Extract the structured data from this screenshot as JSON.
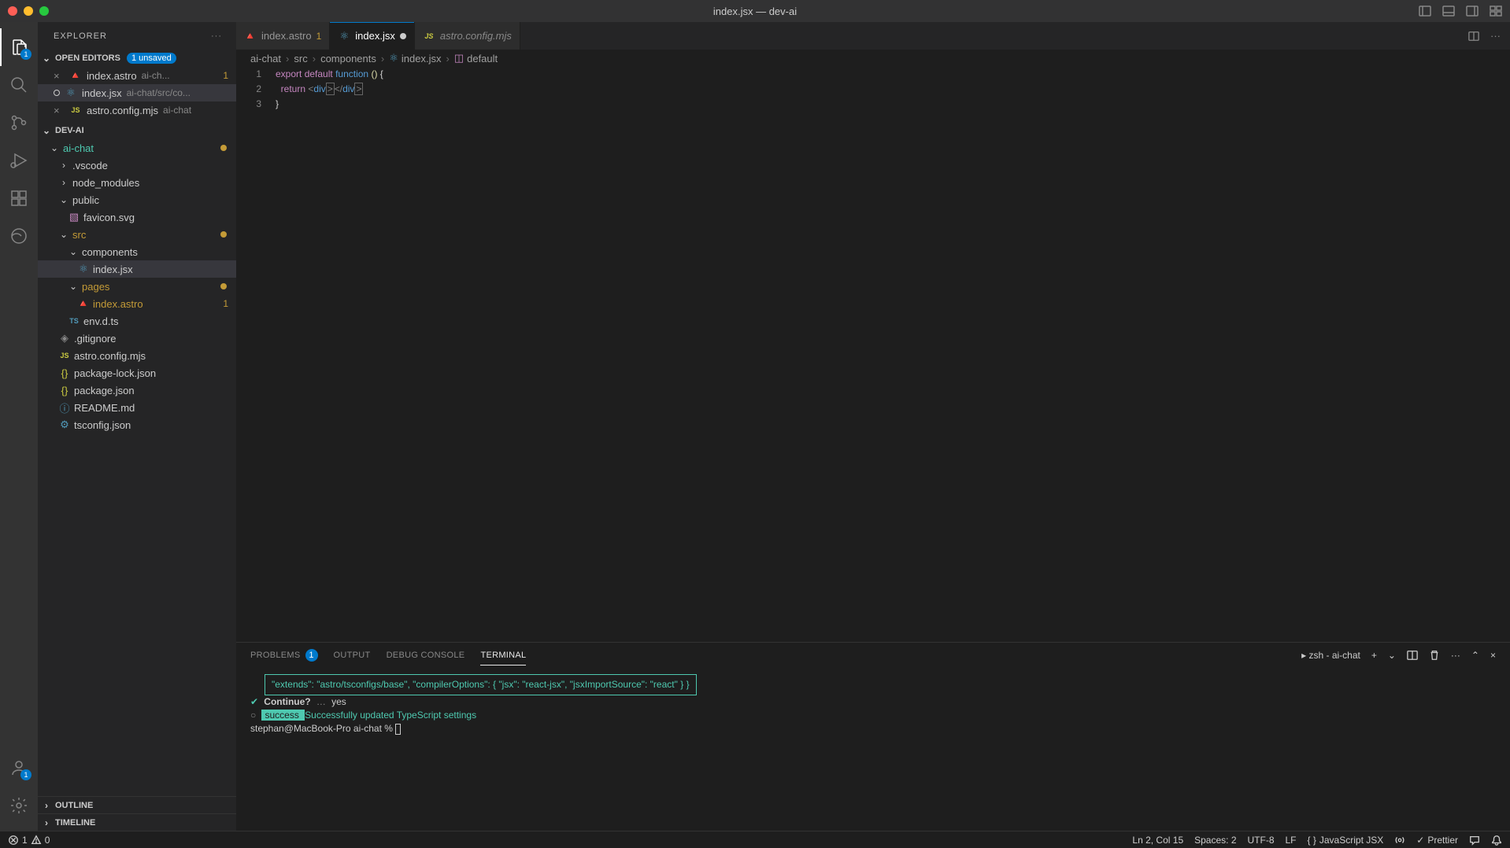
{
  "title_bar": {
    "title": "index.jsx — dev-ai"
  },
  "activity_bar": {
    "explorer_badge": "1",
    "accounts_badge": "1"
  },
  "sidebar": {
    "title": "EXPLORER",
    "open_editors": {
      "label": "OPEN EDITORS",
      "unsaved_badge": "1 unsaved",
      "items": [
        {
          "name": "index.astro",
          "desc": "ai-ch...",
          "warn": "1"
        },
        {
          "name": "index.jsx",
          "desc": "ai-chat/src/co..."
        },
        {
          "name": "astro.config.mjs",
          "desc": "ai-chat"
        }
      ]
    },
    "workspace_label": "DEV-AI",
    "tree": {
      "ai_chat": "ai-chat",
      "vscode": ".vscode",
      "node_modules": "node_modules",
      "public": "public",
      "favicon": "favicon.svg",
      "src": "src",
      "components": "components",
      "index_jsx": "index.jsx",
      "pages": "pages",
      "index_astro": "index.astro",
      "index_astro_warn": "1",
      "env": "env.d.ts",
      "gitignore": ".gitignore",
      "astro_config": "astro.config.mjs",
      "package_lock": "package-lock.json",
      "package_json": "package.json",
      "readme": "README.md",
      "tsconfig": "tsconfig.json"
    },
    "outline_label": "OUTLINE",
    "timeline_label": "TIMELINE"
  },
  "tabs": [
    {
      "name": "index.astro",
      "warn": "1"
    },
    {
      "name": "index.jsx"
    },
    {
      "name": "astro.config.mjs"
    }
  ],
  "breadcrumb": {
    "p0": "ai-chat",
    "p1": "src",
    "p2": "components",
    "p3": "index.jsx",
    "p4": "default"
  },
  "editor": {
    "lines": [
      "1",
      "2",
      "3"
    ],
    "line1_export": "export",
    "line1_default": "default",
    "line1_function": "function",
    "line1_paren": "()",
    "line1_brace": "{",
    "line2_return": "return",
    "line2_div_open": "div",
    "line2_div_close": "div",
    "line3_brace": "}"
  },
  "panel": {
    "tabs": {
      "problems": "PROBLEMS",
      "problems_count": "1",
      "output": "OUTPUT",
      "debug": "DEBUG CONSOLE",
      "terminal": "TERMINAL"
    },
    "terminal_name": "zsh - ai-chat",
    "terminal": {
      "json_l1": "\"extends\": \"astro/tsconfigs/base\",",
      "json_l2": "\"compilerOptions\": {",
      "json_l3": "\"jsx\": \"react-jsx\",",
      "json_l4": "\"jsxImportSource\": \"react\"",
      "json_l5": "}",
      "json_l6": "}",
      "continue_q": "Continue?",
      "continue_dots": "…",
      "continue_a": "yes",
      "success_label": " success ",
      "success_msg": "Successfully updated TypeScript settings",
      "prompt": "stephan@MacBook-Pro ai-chat % "
    }
  },
  "status": {
    "errors": "1",
    "warnings": "0",
    "ln_col": "Ln 2, Col 15",
    "spaces": "Spaces: 2",
    "encoding": "UTF-8",
    "eol": "LF",
    "lang": "JavaScript JSX",
    "prettier": "Prettier"
  }
}
